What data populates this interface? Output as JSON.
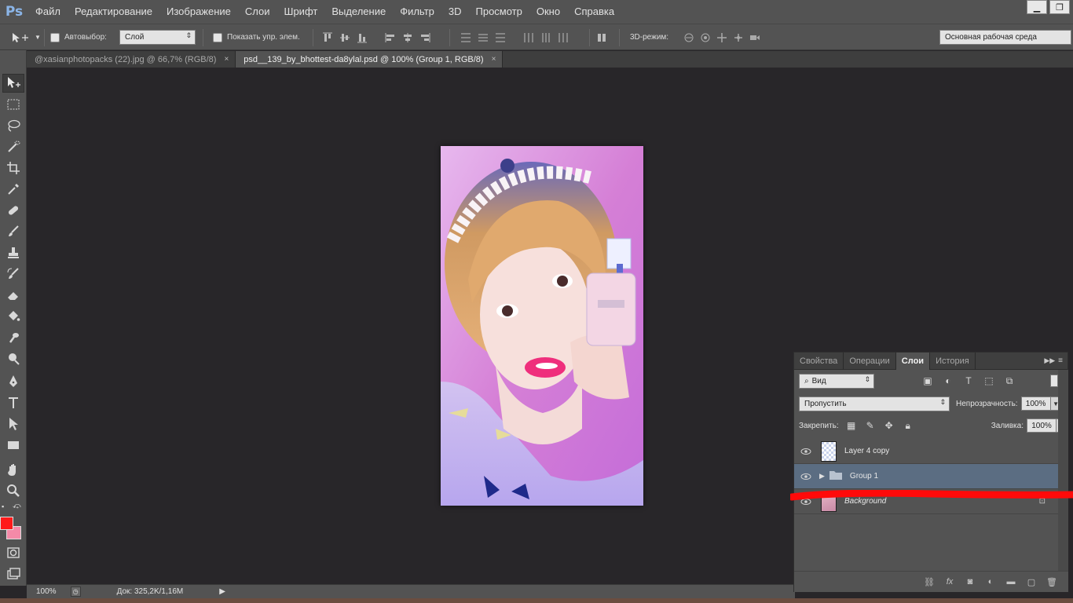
{
  "app": {
    "logo": "Ps"
  },
  "menu": [
    "Файл",
    "Редактирование",
    "Изображение",
    "Слои",
    "Шрифт",
    "Выделение",
    "Фильтр",
    "3D",
    "Просмотр",
    "Окно",
    "Справка"
  ],
  "window_controls": {
    "minimize": "▁",
    "restore": "❐"
  },
  "options": {
    "autoselect_label": "Автовыбор:",
    "autoselect_value": "Слой",
    "show_controls_label": "Показать упр. элем.",
    "mode3d_label": "3D-режим:",
    "workspace": "Основная рабочая среда"
  },
  "tabs": [
    {
      "label": "@xasianphotopacks (22).jpg @ 66,7% (RGB/8)",
      "close": "×"
    },
    {
      "label": "psd__139_by_bhottest-da8ylal.psd @ 100% (Group 1, RGB/8)",
      "close": "×"
    }
  ],
  "colors": {
    "foreground": "#ff1a1a",
    "background": "#f48aa8",
    "accent_red": "#ff0a0a"
  },
  "status": {
    "zoom": "100%",
    "doc": "Док: 325,2K/1,16M"
  },
  "panel": {
    "tabs": [
      "Свойства",
      "Операции",
      "Слои",
      "История"
    ],
    "active_tab": "Слои",
    "filter_kind": "Вид",
    "blend_mode": "Пропустить",
    "opacity_label": "Непрозрачность:",
    "opacity_value": "100%",
    "lock_label": "Закрепить:",
    "fill_label": "Заливка:",
    "fill_value": "100%",
    "layers": [
      {
        "name": "Layer 4 copy"
      },
      {
        "name": "Group 1"
      },
      {
        "name": "Background"
      }
    ]
  }
}
